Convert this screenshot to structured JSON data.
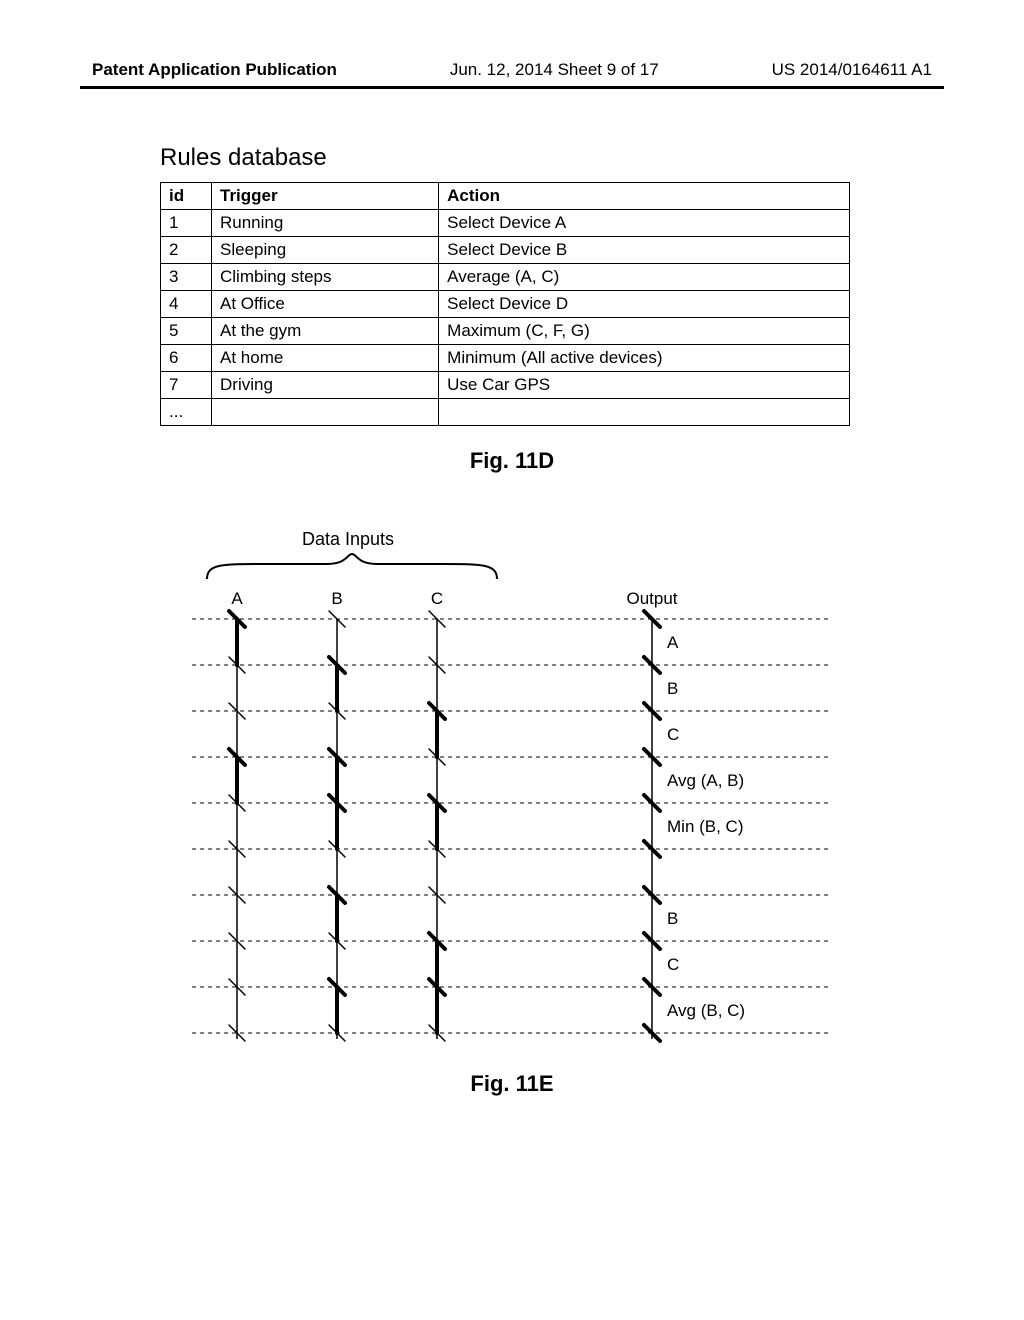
{
  "header": {
    "left": "Patent Application Publication",
    "center": "Jun. 12, 2014  Sheet 9 of 17",
    "right": "US 2014/0164611 A1"
  },
  "rules_database": {
    "title": "Rules database",
    "columns": {
      "id": "id",
      "trigger": "Trigger",
      "action": "Action"
    },
    "rows": [
      {
        "id": "1",
        "trigger": "Running",
        "action": "Select Device A"
      },
      {
        "id": "2",
        "trigger": "Sleeping",
        "action": "Select Device B"
      },
      {
        "id": "3",
        "trigger": "Climbing steps",
        "action": "Average (A, C)"
      },
      {
        "id": "4",
        "trigger": "At Office",
        "action": "Select Device D"
      },
      {
        "id": "5",
        "trigger": "At the gym",
        "action": "Maximum (C, F, G)"
      },
      {
        "id": "6",
        "trigger": "At home",
        "action": "Minimum (All active devices)"
      },
      {
        "id": "7",
        "trigger": "Driving",
        "action": "Use Car GPS"
      },
      {
        "id": "...",
        "trigger": "",
        "action": ""
      }
    ]
  },
  "fig11d_label": "Fig. 11D",
  "diagram": {
    "title": "Data Inputs",
    "columns": [
      "A",
      "B",
      "C"
    ],
    "output_heading": "Output",
    "rows": [
      {
        "active": {
          "A": true,
          "B": false,
          "C": false
        },
        "output": "A"
      },
      {
        "active": {
          "A": false,
          "B": true,
          "C": false
        },
        "output": "B"
      },
      {
        "active": {
          "A": false,
          "B": false,
          "C": true
        },
        "output": "C"
      },
      {
        "active": {
          "A": true,
          "B": true,
          "C": false
        },
        "output": "Avg (A, B)"
      },
      {
        "active": {
          "A": false,
          "B": true,
          "C": true
        },
        "output": "Min (B, C)"
      },
      {
        "active": {
          "A": false,
          "B": false,
          "C": false
        },
        "output": ""
      },
      {
        "active": {
          "A": false,
          "B": true,
          "C": false
        },
        "output": "B"
      },
      {
        "active": {
          "A": false,
          "B": false,
          "C": true
        },
        "output": "C"
      },
      {
        "active": {
          "A": false,
          "B": true,
          "C": true
        },
        "output": "Avg (B, C)"
      }
    ]
  },
  "fig11e_label": "Fig. 11E"
}
